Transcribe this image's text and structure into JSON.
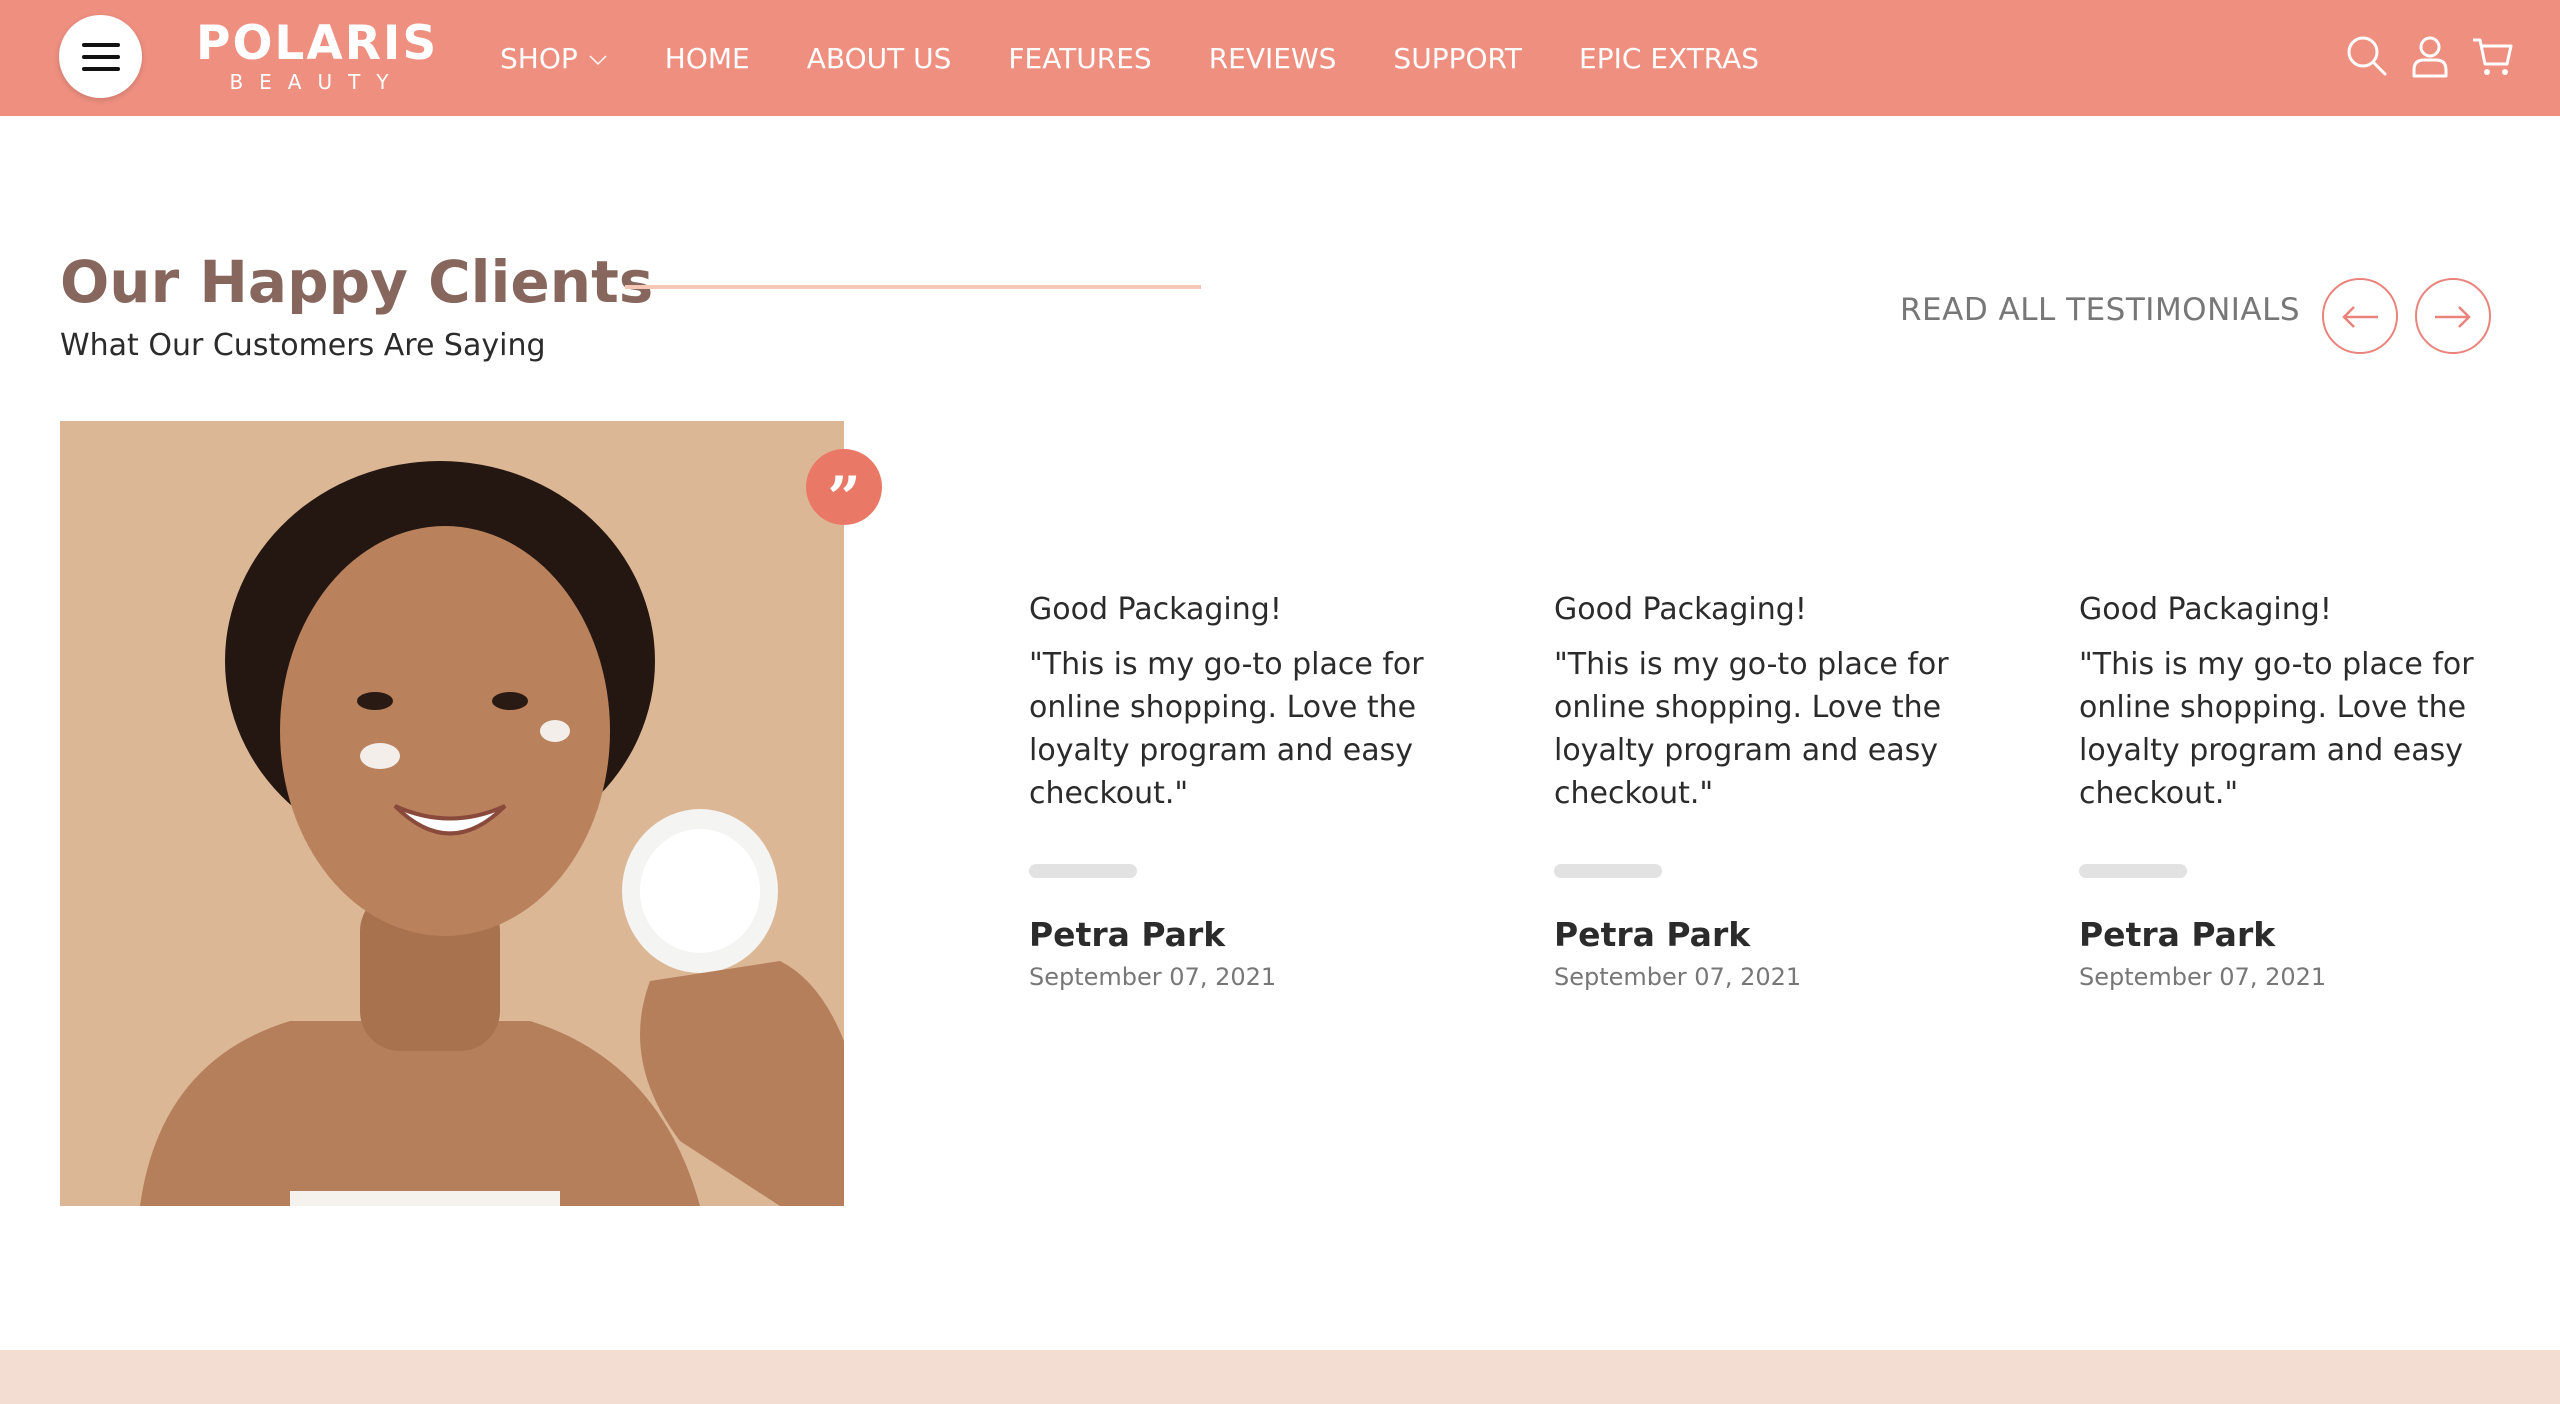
{
  "header": {
    "logo_main": "POLARIS",
    "logo_sub": "BEAUTY",
    "nav": [
      {
        "label": "SHOP",
        "has_dropdown": true
      },
      {
        "label": "HOME"
      },
      {
        "label": "ABOUT US"
      },
      {
        "label": "FEATURES"
      },
      {
        "label": "REVIEWS"
      },
      {
        "label": "SUPPORT"
      },
      {
        "label": "EPIC EXTRAS"
      }
    ],
    "icons": [
      "menu-icon",
      "search-icon",
      "user-icon",
      "cart-icon"
    ]
  },
  "section": {
    "title": "Our Happy Clients",
    "subtitle": "What Our Customers Are Saying",
    "read_all": "READ ALL TESTIMONIALS",
    "arrows": [
      "arrow-left-icon",
      "arrow-right-icon"
    ]
  },
  "testimonials": [
    {
      "title": "Good Packaging!",
      "text": "\"This is my go-to place for online shopping. Love the loyalty program and easy checkout.\"",
      "name": "Petra Park",
      "date": "September 07, 2021"
    },
    {
      "title": "Good Packaging!",
      "text": "\"This is my go-to place for online shopping. Love the loyalty program and easy checkout.\"",
      "name": "Petra Park",
      "date": "September 07, 2021"
    },
    {
      "title": "Good Packaging!",
      "text": "\"This is my go-to place for online shopping. Love the loyalty program and easy checkout.\"",
      "name": "Petra Park",
      "date": "September 07, 2021"
    }
  ],
  "colors": {
    "header_bg": "#ee8f80",
    "title": "#86665d",
    "accent": "#ea7867",
    "photo_bg": "#dcb795",
    "footer_band": "#f3dcd1"
  }
}
